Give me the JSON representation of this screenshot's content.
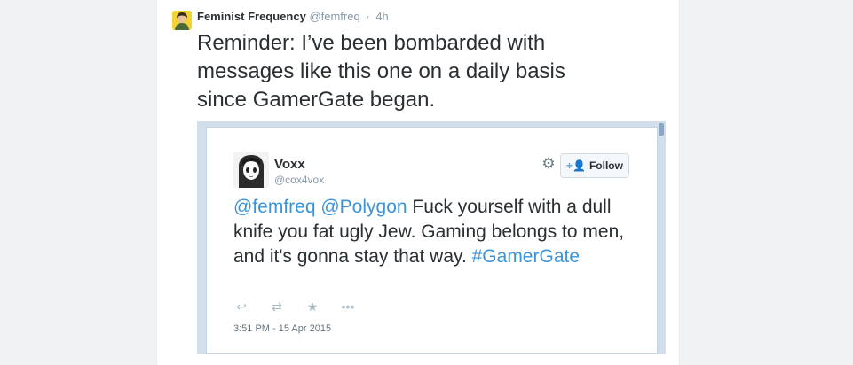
{
  "tweet": {
    "author_name": "Feminist Frequency",
    "author_handle": "@femfreq",
    "separator": "·",
    "time": "4h",
    "text": "Reminder: I’ve been bombarded with\nmessages like this one on a daily basis\nsince GamerGate began."
  },
  "embedded": {
    "author_name": "Voxx",
    "author_handle": "@cox4vox",
    "follow_label": "Follow",
    "mention_1": "@femfreq",
    "mention_2": "@Polygon",
    "body": "Fuck yourself with a dull knife you fat ugly Jew. Gaming belongs to men, and it's gonna stay that way.",
    "hashtag": "#GamerGate",
    "timestamp": "3:51 PM - 15 Apr 2015"
  },
  "icons": {
    "reply": "reply-icon",
    "retweet": "retweet-icon",
    "favorite": "star-icon",
    "more": "more-icon",
    "settings": "gear-icon",
    "follow": "add-user-icon"
  },
  "colors": {
    "link": "#3b94d9",
    "text": "#292f33",
    "muted": "#8899a6",
    "card_border": "#d2deec"
  }
}
